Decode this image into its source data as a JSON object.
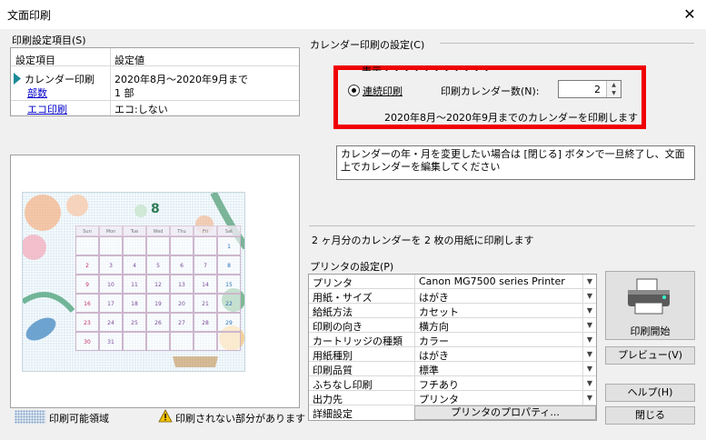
{
  "window": {
    "title": "文面印刷",
    "close_glyph": "✕"
  },
  "left": {
    "group_label": "印刷設定項目(S)",
    "table": {
      "headers": [
        "設定項目",
        "設定値"
      ],
      "rows": [
        {
          "label": "カレンダー印刷",
          "value": "2020年8月～2020年9月まで"
        },
        {
          "label": "部数",
          "value": "1 部"
        },
        {
          "label": "エコ印刷",
          "value": "エコ:しない"
        }
      ]
    },
    "legend_printable": "印刷可能領域",
    "legend_warning": "印刷されない部分があります"
  },
  "calendar_group": {
    "label": "カレンダー印刷の設定(C)",
    "radio_hidden_label": "表示・・・・・・・・・・・",
    "radio_selected_label": "連続印刷",
    "count_label": "印刷カレンダー数(N):",
    "count_value": "2",
    "summary": "2020年8月～2020年9月までのカレンダーを印刷します"
  },
  "note": "カレンダーの年・月を変更したい場合は [閉じる] ボタンで一旦終了し、文面上でカレンダーを編集してください",
  "info": "2 ヶ月分のカレンダーを 2 枚の用紙に印刷します",
  "printer": {
    "group_label": "プリンタの設定(P)",
    "rows": [
      {
        "label": "プリンタ",
        "value": "Canon MG7500 series Printer"
      },
      {
        "label": "用紙・サイズ",
        "value": "はがき"
      },
      {
        "label": "給紙方法",
        "value": "カセット"
      },
      {
        "label": "印刷の向き",
        "value": "横方向"
      },
      {
        "label": "カートリッジの種類",
        "value": "カラー"
      },
      {
        "label": "用紙種別",
        "value": "はがき"
      },
      {
        "label": "印刷品質",
        "value": "標準"
      },
      {
        "label": "ふちなし印刷",
        "value": "フチあり"
      },
      {
        "label": "出力先",
        "value": "プリンタ"
      }
    ],
    "detail_label": "詳細設定",
    "properties_button": "プリンタのプロパティ..."
  },
  "buttons": {
    "print": "印刷開始",
    "preview": "プレビュー(V)",
    "help": "ヘルプ(H)",
    "close": "閉じる"
  },
  "calendar_preview": {
    "month_title": "8",
    "weekdays": [
      "Sun",
      "Mon",
      "Tue",
      "Wed",
      "Thu",
      "Fri",
      "Sat"
    ],
    "days": [
      "",
      "",
      "",
      "",
      "",
      "",
      "1",
      "2",
      "3",
      "4",
      "5",
      "6",
      "7",
      "8",
      "9",
      "10",
      "11",
      "12",
      "13",
      "14",
      "15",
      "16",
      "17",
      "18",
      "19",
      "20",
      "21",
      "22",
      "23",
      "24",
      "25",
      "26",
      "27",
      "28",
      "29",
      "30",
      "31",
      "",
      "",
      "",
      "",
      ""
    ]
  },
  "colors": {
    "highlight": "#f00000",
    "link": "#0000cc",
    "accent_teal": "#1a8a9a"
  }
}
